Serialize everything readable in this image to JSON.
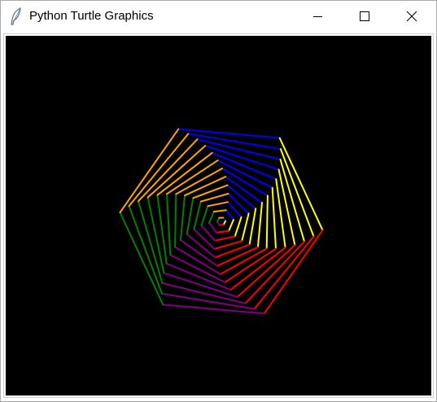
{
  "window": {
    "title": "Python Turtle Graphics",
    "controls": {
      "minimize_icon": "minimize-icon",
      "maximize_icon": "maximize-icon",
      "close_icon": "close-icon"
    }
  },
  "canvas": {
    "background": "#000000",
    "pattern": {
      "colors": [
        "#0000ff",
        "#ffff00",
        "#ff0000",
        "#800080",
        "#008000",
        "#ffa500"
      ],
      "sides": 6,
      "lines_per_side": 13,
      "shape": "nested rotating hexagon spiral"
    }
  }
}
